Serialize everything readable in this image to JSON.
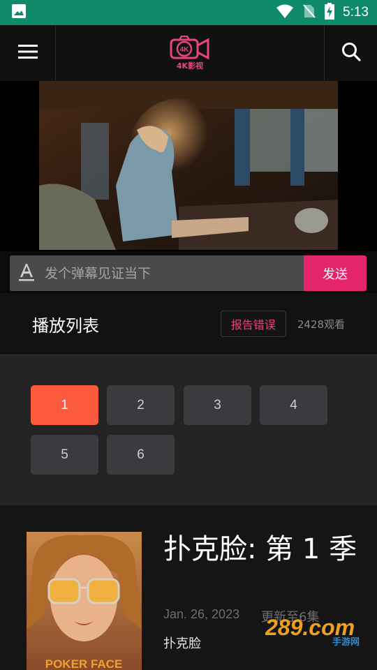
{
  "status_bar": {
    "time": "5:13",
    "icons": [
      "image-icon",
      "wifi-icon",
      "no-sim-icon",
      "battery-charging-icon"
    ]
  },
  "app_bar": {
    "logo_badge": "4K",
    "logo_text": "4K影视",
    "brand_color": "#e8447f",
    "icons": [
      "menu-icon",
      "search-icon"
    ]
  },
  "danmaku": {
    "placeholder": "发个弹幕见证当下",
    "send_label": "发送",
    "icon": "font-a-icon"
  },
  "playlist": {
    "title": "播放列表",
    "report_label": "报告错误",
    "views": "2428观看"
  },
  "episodes": {
    "items": [
      "1",
      "2",
      "3",
      "4",
      "5",
      "6"
    ],
    "active": "1",
    "active_color": "#fb5a3e"
  },
  "show": {
    "title": "扑克脸: 第 1 季",
    "date": "Jan. 26, 2023",
    "update": "更新至6集",
    "subtitle": "扑克脸",
    "poster_text": "POKER FACE"
  },
  "watermark": {
    "text": "289.com",
    "sub": "手游网"
  }
}
